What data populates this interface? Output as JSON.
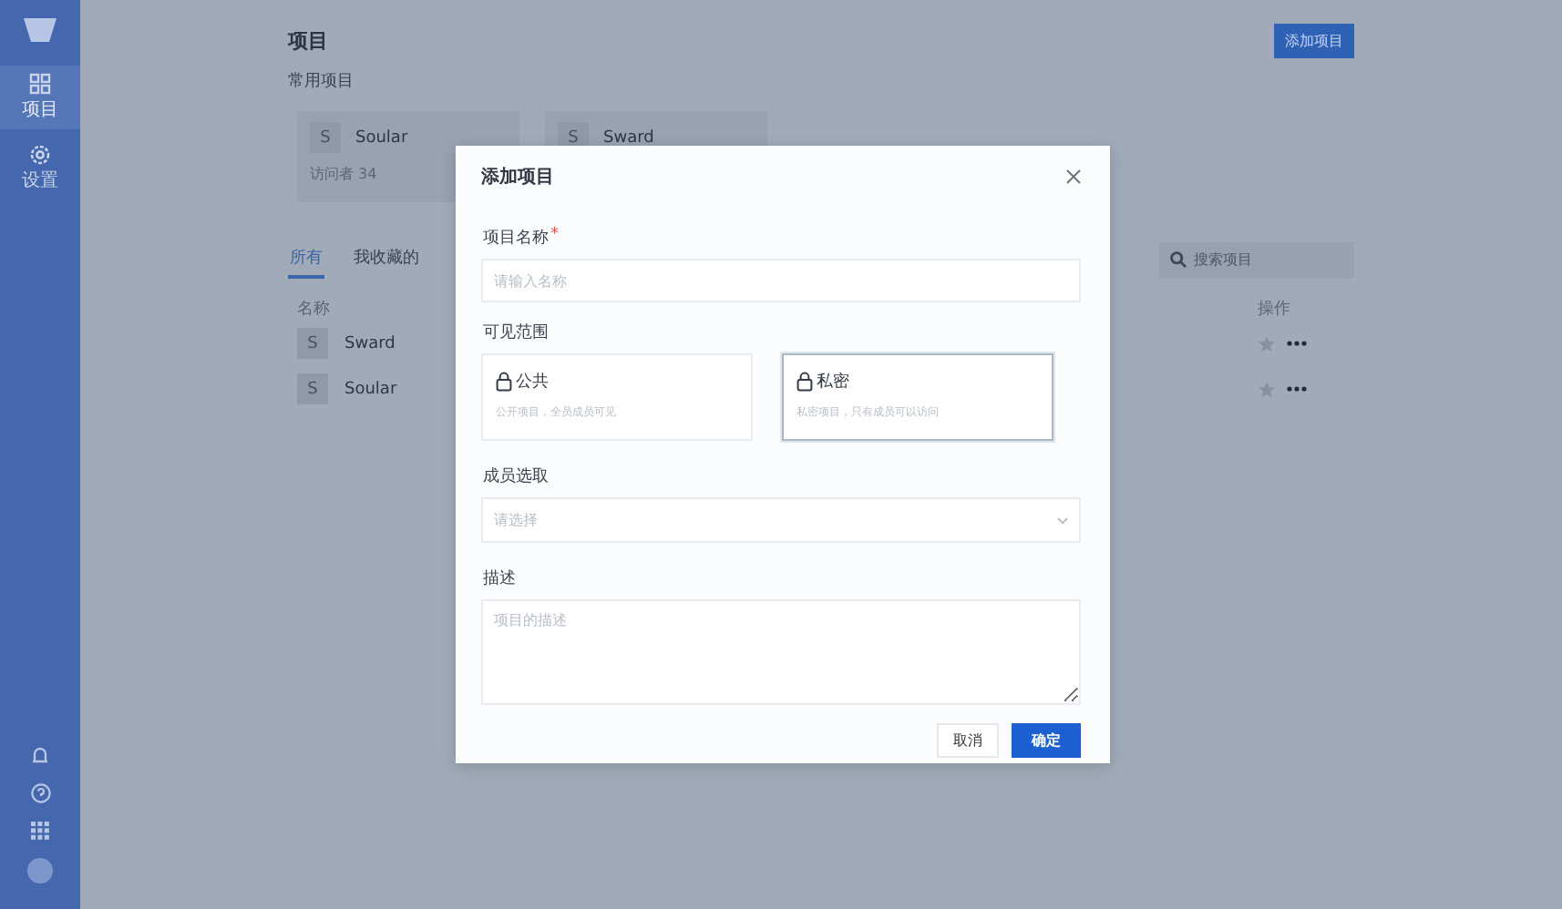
{
  "sidebar": {
    "items": [
      {
        "kind": "projects",
        "label": "项目",
        "selected": true
      },
      {
        "kind": "settings",
        "label": "设置",
        "selected": false
      }
    ]
  },
  "page": {
    "title": "项目",
    "add_button": "添加项目",
    "favorites_title": "常用项目",
    "favorites": [
      {
        "avatar": "S",
        "name": "Soular",
        "meta": "访问者 34"
      },
      {
        "avatar": "S",
        "name": "Sward"
      }
    ],
    "tabs": [
      {
        "label": "所有",
        "selected": true
      },
      {
        "label": "我收藏的",
        "selected": false
      }
    ],
    "search": {
      "placeholder": "搜索项目"
    },
    "table": {
      "columns": [
        "名称",
        "操作"
      ],
      "rows": [
        {
          "avatar": "S",
          "name": "Sward"
        },
        {
          "avatar": "S",
          "name": "Soular"
        }
      ]
    }
  },
  "dialog": {
    "title": "添加项目",
    "name_field": {
      "label": "项目名称",
      "required_mark": "*",
      "placeholder": "请输入名称"
    },
    "visibility": {
      "label": "可见范围",
      "options": [
        {
          "title": "公共",
          "description": "公开项目，全员成员可见",
          "selected": false
        },
        {
          "title": "私密",
          "description": "私密项目，只有成员可以访问",
          "selected": true
        }
      ]
    },
    "members_field": {
      "label": "成员选取",
      "placeholder": "请选择"
    },
    "description_field": {
      "label": "描述",
      "placeholder": "项目的描述"
    },
    "buttons": [
      {
        "kind": "secondary",
        "label": "取消"
      },
      {
        "kind": "primary",
        "label": "确定"
      }
    ]
  }
}
